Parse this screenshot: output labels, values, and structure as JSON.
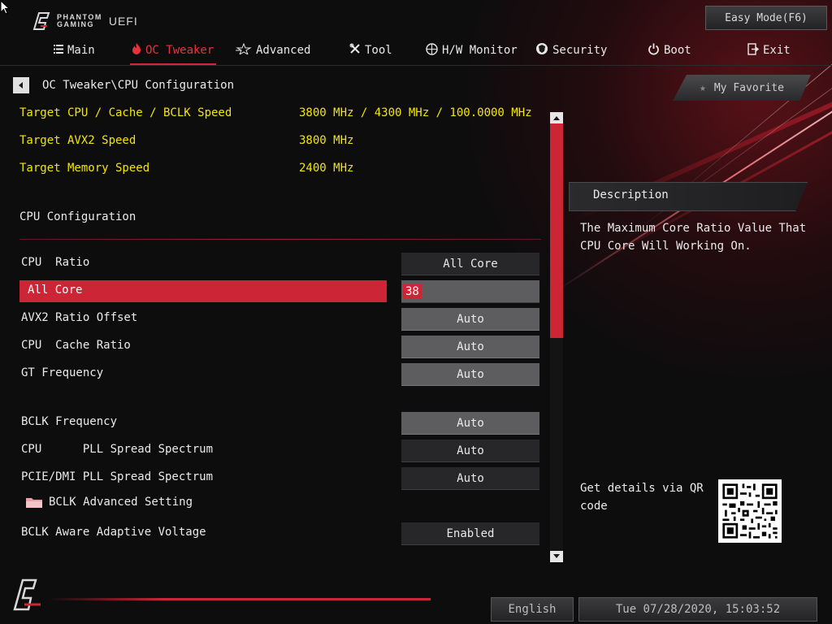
{
  "brand": {
    "line1": "PHANTOM",
    "line2": "GAMING",
    "uefi": "UEFI"
  },
  "easy_mode": "Easy Mode(F6)",
  "nav": [
    {
      "label": "Main",
      "icon": "list-icon"
    },
    {
      "label": "OC Tweaker",
      "icon": "flame-icon",
      "active": true
    },
    {
      "label": "Advanced",
      "icon": "star-icon"
    },
    {
      "label": "Tool",
      "icon": "wrench-icon"
    },
    {
      "label": "H/W Monitor",
      "icon": "gauge-icon"
    },
    {
      "label": "Security",
      "icon": "shield-icon"
    },
    {
      "label": "Boot",
      "icon": "power-icon"
    },
    {
      "label": "Exit",
      "icon": "exit-icon"
    }
  ],
  "breadcrumb": "OC Tweaker\\CPU Configuration",
  "targets": [
    {
      "label": "Target CPU / Cache / BCLK Speed",
      "value": "3800 MHz / 4300 MHz / 100.0000 MHz"
    },
    {
      "label": "Target AVX2 Speed",
      "value": "3800 MHz"
    },
    {
      "label": "Target Memory Speed",
      "value": "2400 MHz"
    }
  ],
  "section_title": "CPU Configuration",
  "settings": [
    {
      "label": "CPU  Ratio",
      "value": "All Core"
    },
    {
      "label": "All Core",
      "value": "38"
    },
    {
      "label": "AVX2 Ratio Offset",
      "value": "Auto"
    },
    {
      "label": "CPU  Cache Ratio",
      "value": "Auto"
    },
    {
      "label": "GT Frequency",
      "value": "Auto"
    },
    {
      "label": "BCLK Frequency",
      "value": "Auto"
    },
    {
      "label": "CPU      PLL Spread Spectrum",
      "value": "Auto"
    },
    {
      "label": "PCIE/DMI PLL Spread Spectrum",
      "value": "Auto"
    },
    {
      "label": "BCLK Aware Adaptive Voltage",
      "value": "Enabled"
    }
  ],
  "folder": {
    "label": "BCLK Advanced Setting",
    "icon": "folder-icon"
  },
  "my_favorite": "My Favorite",
  "description": {
    "title": "Description",
    "text": "The Maximum Core Ratio Value That CPU Core Will Working On."
  },
  "qr": {
    "text": "Get details via QR code"
  },
  "footer": {
    "language": "English",
    "datetime": "Tue 07/28/2020, 15:03:52"
  },
  "colors": {
    "accent": "#cc2535",
    "target_text": "#f2e600",
    "background": "#0d0d0e"
  }
}
